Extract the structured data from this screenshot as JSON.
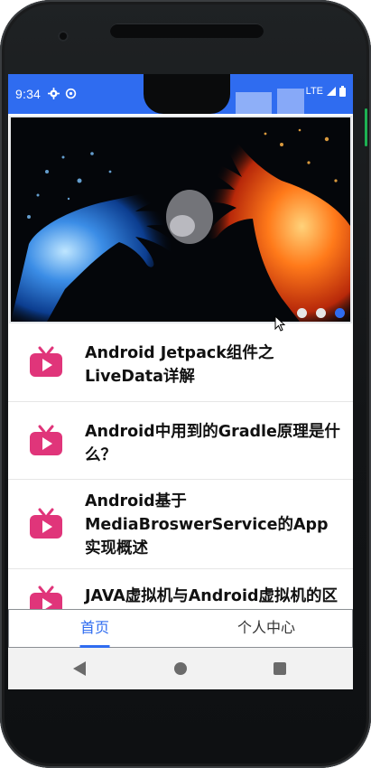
{
  "status_bar": {
    "time": "9:34",
    "network": "LTE",
    "icons": [
      "gear-icon",
      "vpn-icon",
      "signal-icon",
      "battery-icon"
    ]
  },
  "banner": {
    "pages": 3,
    "active_index": 2,
    "image_subject": "fire-and-water-hands"
  },
  "articles": [
    {
      "title": "Android Jetpack组件之LiveData详解",
      "icon": "tv-icon"
    },
    {
      "title": "Android中用到的Gradle原理是什么？",
      "icon": "tv-icon"
    },
    {
      "title": "Android基于MediaBroswerService的App实现概述",
      "icon": "tv-icon"
    },
    {
      "title": "JAVA虚拟机与Android虚拟机的区",
      "icon": "tv-icon"
    }
  ],
  "tabs": [
    {
      "label": "首页",
      "active": true
    },
    {
      "label": "个人中心",
      "active": false
    }
  ],
  "nav": {
    "icons": [
      "back-icon",
      "home-icon",
      "recents-icon"
    ]
  },
  "colors": {
    "primary": "#2f6cf0",
    "icon_pink": "#e0357a",
    "text": "#111111",
    "divider": "#e6e6e6"
  }
}
